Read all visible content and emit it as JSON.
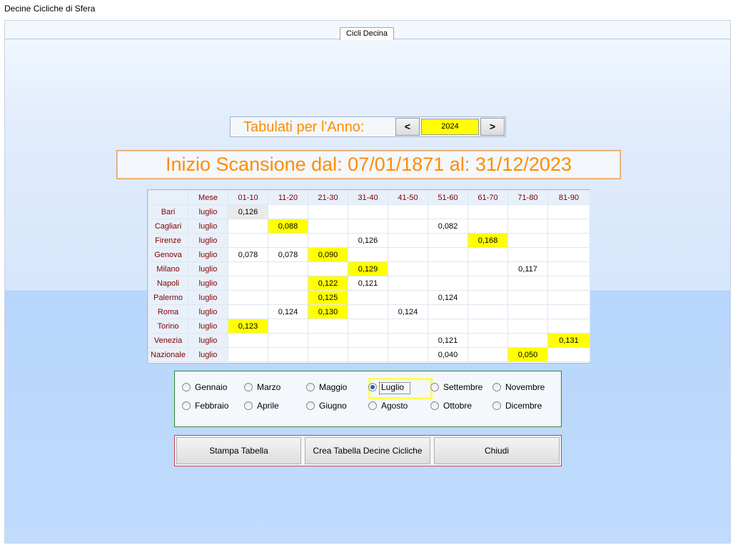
{
  "window": {
    "title": "Decine Cicliche di Sfera"
  },
  "tab": {
    "label": "Cicli Decina"
  },
  "year": {
    "label": "Tabulati per l'Anno:",
    "value": "2024",
    "prev": "<",
    "next": ">"
  },
  "scan": {
    "text": "Inizio Scansione dal: 07/01/1871 al: 31/12/2023"
  },
  "grid": {
    "columns": [
      "",
      "Mese",
      "01-10",
      "11-20",
      "21-30",
      "31-40",
      "41-50",
      "51-60",
      "61-70",
      "71-80",
      "81-90"
    ],
    "rows": [
      {
        "city": "Bari",
        "month": "luglio",
        "cells": [
          "0,126",
          "",
          "",
          "",
          "",
          "",
          "",
          "",
          ""
        ],
        "highlight": [],
        "selected": [
          0
        ]
      },
      {
        "city": "Cagliari",
        "month": "luglio",
        "cells": [
          "",
          "0,088",
          "",
          "",
          "",
          "0,082",
          "",
          "",
          ""
        ],
        "highlight": [
          1
        ],
        "selected": []
      },
      {
        "city": "Firenze",
        "month": "luglio",
        "cells": [
          "",
          "",
          "",
          "0,126",
          "",
          "",
          "0,168",
          "",
          ""
        ],
        "highlight": [
          6
        ],
        "selected": []
      },
      {
        "city": "Genova",
        "month": "luglio",
        "cells": [
          "0,078",
          "0,078",
          "0,090",
          "",
          "",
          "",
          "",
          "",
          ""
        ],
        "highlight": [
          2
        ],
        "selected": []
      },
      {
        "city": "Milano",
        "month": "luglio",
        "cells": [
          "",
          "",
          "",
          "0,129",
          "",
          "",
          "",
          "0,117",
          ""
        ],
        "highlight": [
          3
        ],
        "selected": []
      },
      {
        "city": "Napoli",
        "month": "luglio",
        "cells": [
          "",
          "",
          "0,122",
          "0,121",
          "",
          "",
          "",
          "",
          ""
        ],
        "highlight": [
          2
        ],
        "selected": []
      },
      {
        "city": "Palermo",
        "month": "luglio",
        "cells": [
          "",
          "",
          "0,125",
          "",
          "",
          "0,124",
          "",
          "",
          ""
        ],
        "highlight": [
          2
        ],
        "selected": []
      },
      {
        "city": "Roma",
        "month": "luglio",
        "cells": [
          "",
          "0,124",
          "0,130",
          "",
          "0,124",
          "",
          "",
          "",
          ""
        ],
        "highlight": [
          2
        ],
        "selected": []
      },
      {
        "city": "Torino",
        "month": "luglio",
        "cells": [
          "0,123",
          "",
          "",
          "",
          "",
          "",
          "",
          "",
          ""
        ],
        "highlight": [
          0
        ],
        "selected": []
      },
      {
        "city": "Venezia",
        "month": "luglio",
        "cells": [
          "",
          "",
          "",
          "",
          "",
          "0,121",
          "",
          "",
          "0,131"
        ],
        "highlight": [
          8
        ],
        "selected": []
      },
      {
        "city": "Nazionale",
        "month": "luglio",
        "cells": [
          "",
          "",
          "",
          "",
          "",
          "0,040",
          "",
          "0,050",
          ""
        ],
        "highlight": [
          7
        ],
        "selected": []
      }
    ],
    "highlight_color": "#ffff00"
  },
  "months": {
    "options": [
      "Gennaio",
      "Febbraio",
      "Marzo",
      "Aprile",
      "Maggio",
      "Giugno",
      "Luglio",
      "Agosto",
      "Settembre",
      "Ottobre",
      "Novembre",
      "Dicembre"
    ],
    "selected": "Luglio"
  },
  "buttons": {
    "print": "Stampa Tabella",
    "create": "Crea Tabella Decine Cicliche",
    "close": "Chiudi"
  },
  "colors": {
    "accent_orange": "#ff8c00",
    "year_field": "#ffff00",
    "months_border": "#2e8b2e",
    "buttons_border": "#d23c4a",
    "header_text": "#800000"
  }
}
